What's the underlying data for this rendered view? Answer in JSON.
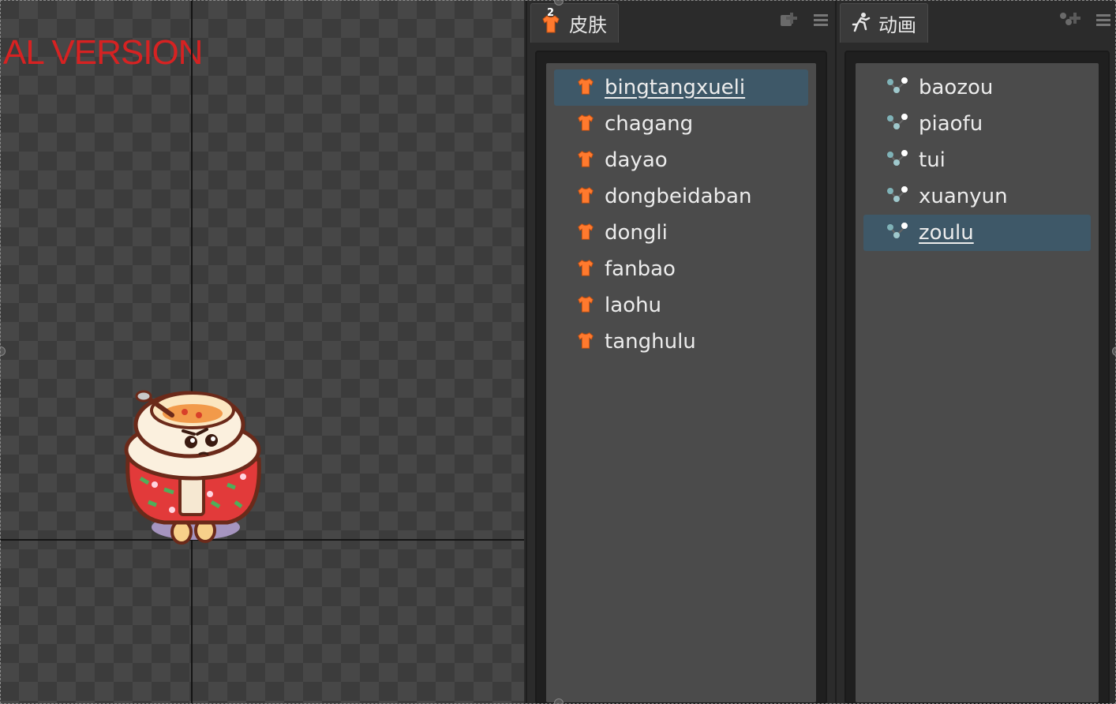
{
  "viewport": {
    "watermark": "AL VERSION"
  },
  "skins_panel": {
    "tab_label": "皮肤",
    "tab_badge": "2",
    "items": [
      {
        "label": "bingtangxueli",
        "selected": true
      },
      {
        "label": "chagang",
        "selected": false
      },
      {
        "label": "dayao",
        "selected": false
      },
      {
        "label": "dongbeidaban",
        "selected": false
      },
      {
        "label": "dongli",
        "selected": false
      },
      {
        "label": "fanbao",
        "selected": false
      },
      {
        "label": "laohu",
        "selected": false
      },
      {
        "label": "tanghulu",
        "selected": false
      }
    ]
  },
  "animations_panel": {
    "tab_label": "动画",
    "items": [
      {
        "label": "baozou",
        "selected": false
      },
      {
        "label": "piaofu",
        "selected": false
      },
      {
        "label": "tui",
        "selected": false
      },
      {
        "label": "xuanyun",
        "selected": false
      },
      {
        "label": "zoulu",
        "selected": true
      }
    ]
  },
  "icons": {
    "skin_tab": "shirt-icon",
    "anim_tab": "running-figure-icon",
    "skin_item": "shirt-icon",
    "anim_item": "animation-nodes-icon",
    "add": "add-icon",
    "menu": "hamburger-menu-icon"
  },
  "colors": {
    "accent_orange": "#ff7a2e",
    "selection": "#3e5868",
    "watermark_red": "#d62222"
  }
}
